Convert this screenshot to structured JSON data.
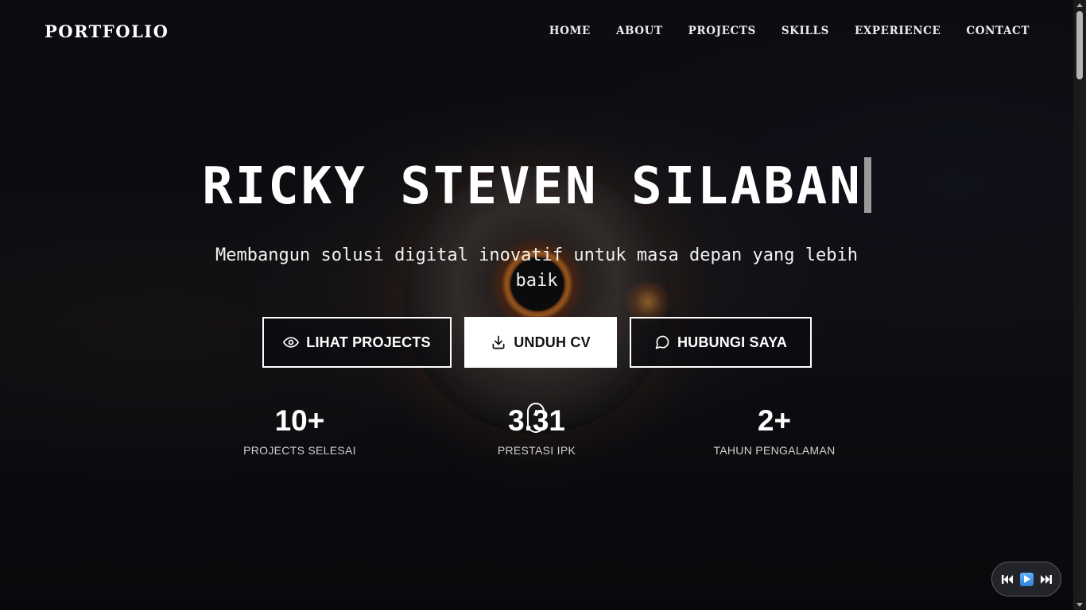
{
  "nav": {
    "logo": "PORTFOLIO",
    "links": [
      "HOME",
      "ABOUT",
      "PROJECTS",
      "SKILLS",
      "EXPERIENCE",
      "CONTACT"
    ]
  },
  "hero": {
    "title": "RICKY STEVEN SILABAN",
    "subtitle": "Membangun solusi digital inovatif untuk masa depan yang lebih baik",
    "buttons": {
      "projects": "LIHAT PROJECTS",
      "cv": "UNDUH CV",
      "contact": "HUBUNGI SAYA"
    }
  },
  "stats": [
    {
      "value": "10+",
      "label": "PROJECTS SELESAI"
    },
    {
      "value": "3.31",
      "label": "PRESTASI IPK"
    },
    {
      "value": "2+",
      "label": "TAHUN PENGALAMAN"
    }
  ],
  "player": {
    "prev_icon": "skip-previous-icon",
    "play_icon": "play-icon",
    "next_icon": "skip-next-icon"
  },
  "colors": {
    "background": "#0b0b0f",
    "text": "#ffffff",
    "accent_glow": "#f08a2a"
  }
}
